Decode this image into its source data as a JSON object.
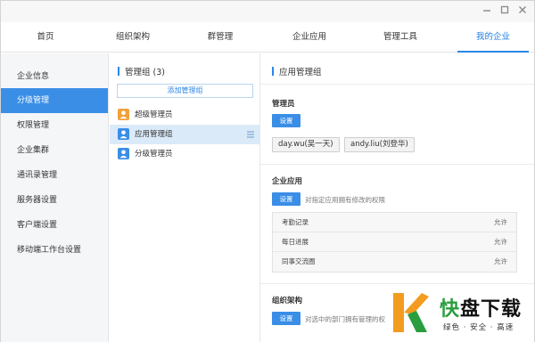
{
  "top_tabs": [
    "首页",
    "组织架构",
    "群管理",
    "企业应用",
    "管理工具",
    "我的企业"
  ],
  "sidebar": {
    "items": [
      "企业信息",
      "分级管理",
      "权限管理",
      "企业集群",
      "通讯录管理",
      "服务器设置",
      "客户端设置",
      "移动端工作台设置"
    ]
  },
  "groups_panel": {
    "title": "管理组 (3)",
    "add_button": "添加管理组",
    "items": [
      "超级管理员",
      "应用管理组",
      "分级管理员"
    ]
  },
  "detail": {
    "title": "应用管理组",
    "admins_label": "管理员",
    "settings_button": "设置",
    "admins": [
      "day.wu(吴一天)",
      "andy.liu(刘登华)"
    ],
    "apps_label": "企业应用",
    "apps_hint": "对指定应用拥有修改的权限",
    "apps": [
      {
        "name": "考勤记录",
        "value": "允许"
      },
      {
        "name": "每日进展",
        "value": "允许"
      },
      {
        "name": "同事交流圈",
        "value": "允许"
      }
    ],
    "org_label": "组织架构",
    "org_hint": "对选中的部门拥有管理的权"
  },
  "watermark": {
    "title_green": "快",
    "title_rest": "盘下载",
    "subtitle": "绿色 · 安全 · 高速"
  },
  "colors": {
    "accent": "#3a8ee6",
    "tab_active": "#1d7de2",
    "super_admin_icon": "#f0a23b",
    "app_admin_icon": "#3a8ee6",
    "sub_admin_icon": "#3a8ee6",
    "watermark_green": "#2a9d3f",
    "watermark_orange": "#f39c1f"
  }
}
